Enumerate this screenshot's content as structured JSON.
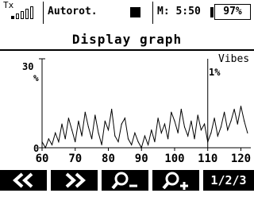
{
  "status": {
    "tx_label": "Tx",
    "model_name": "Autorot.",
    "timer": "M: 5:50",
    "battery": "97%",
    "battery_level": 0.97,
    "signal_bars_active": 1,
    "signal_bars_total": 5
  },
  "title": "Display graph",
  "graph": {
    "y_max_label": "30",
    "y_unit": "%",
    "y_min_label": "0",
    "series_label": "Vibes",
    "cursor_label": "1%",
    "cursor_x": 110,
    "x_ticks": [
      "60",
      "70",
      "80",
      "90",
      "100",
      "110",
      "120"
    ]
  },
  "chart_data": {
    "type": "line",
    "series": [
      {
        "name": "Vibes",
        "x": [
          60,
          61,
          62,
          63,
          64,
          65,
          66,
          67,
          68,
          69,
          70,
          71,
          72,
          73,
          74,
          75,
          76,
          77,
          78,
          79,
          80,
          81,
          82,
          83,
          84,
          85,
          86,
          87,
          88,
          89,
          90,
          91,
          92,
          93,
          94,
          95,
          96,
          97,
          98,
          99,
          100,
          101,
          102,
          103,
          104,
          105,
          106,
          107,
          108,
          109,
          110,
          111,
          112,
          113,
          114,
          115,
          116,
          117,
          118,
          119,
          120,
          121,
          122
        ],
        "values": [
          2,
          0,
          3,
          1,
          5,
          2,
          8,
          3,
          10,
          6,
          2,
          9,
          4,
          12,
          7,
          3,
          11,
          5,
          1,
          9,
          6,
          13,
          4,
          2,
          8,
          10,
          3,
          1,
          5,
          2,
          0,
          4,
          1,
          6,
          2,
          10,
          5,
          8,
          3,
          12,
          9,
          5,
          13,
          7,
          4,
          9,
          3,
          11,
          6,
          8,
          2,
          5,
          10,
          4,
          7,
          12,
          6,
          9,
          13,
          8,
          14,
          9,
          5
        ],
        "color": "#000000"
      }
    ],
    "xlim": [
      60,
      123
    ],
    "ylim": [
      0,
      30
    ],
    "x_ticks": [
      60,
      70,
      80,
      90,
      100,
      110,
      120
    ],
    "cursor_x": 110,
    "cursor_value": "1%"
  },
  "buttons": [
    {
      "id": "prev",
      "label": "<<"
    },
    {
      "id": "next",
      "label": ">>"
    },
    {
      "id": "zoom-out",
      "label": "P-"
    },
    {
      "id": "zoom-in",
      "label": "P+"
    },
    {
      "id": "page",
      "label": "1/2/3"
    }
  ]
}
